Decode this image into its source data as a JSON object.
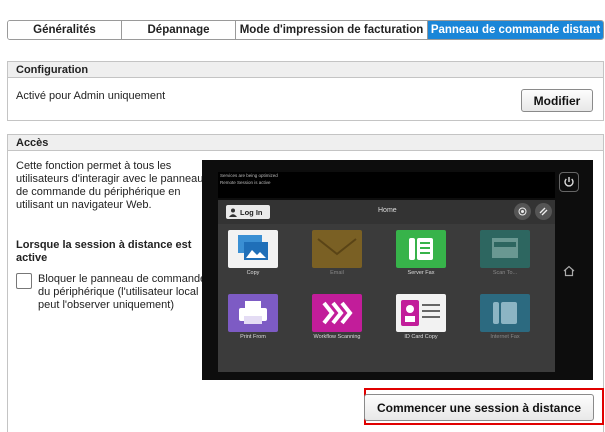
{
  "tabs": [
    {
      "label": "Généralités"
    },
    {
      "label": "Dépannage"
    },
    {
      "label": "Mode d'impression de facturation"
    },
    {
      "label": "Panneau de commande distant",
      "active": true
    }
  ],
  "configuration": {
    "title": "Configuration",
    "status": "Activé pour Admin uniquement",
    "modify_label": "Modifier"
  },
  "access": {
    "title": "Accès",
    "description": "Cette fonction permet à tous les utilisateurs d'interagir avec le panneau de commande du périphérique en utilisant un navigateur Web.",
    "session_heading": "Lorsque la session à distance est active",
    "lock_checkbox_label": "Bloquer le panneau de commande du périphérique (l'utilisateur local peut l'observer uniquement)",
    "start_button_label": "Commencer une session à distance",
    "lock_checked": false
  },
  "device": {
    "status_line1": "Services are being optimized",
    "status_line2": "Remote Session is active",
    "login_label": "Log In",
    "home_label": "Home",
    "apps": [
      {
        "label": "Copy"
      },
      {
        "label": "Email"
      },
      {
        "label": "Server Fax"
      },
      {
        "label": "Scan To..."
      },
      {
        "label": "Print From"
      },
      {
        "label": "Workflow Scanning"
      },
      {
        "label": "ID Card Copy"
      },
      {
        "label": "Internet Fax"
      }
    ]
  },
  "colors": {
    "active_tab": "#1a86d8",
    "highlight": "#e00000"
  }
}
